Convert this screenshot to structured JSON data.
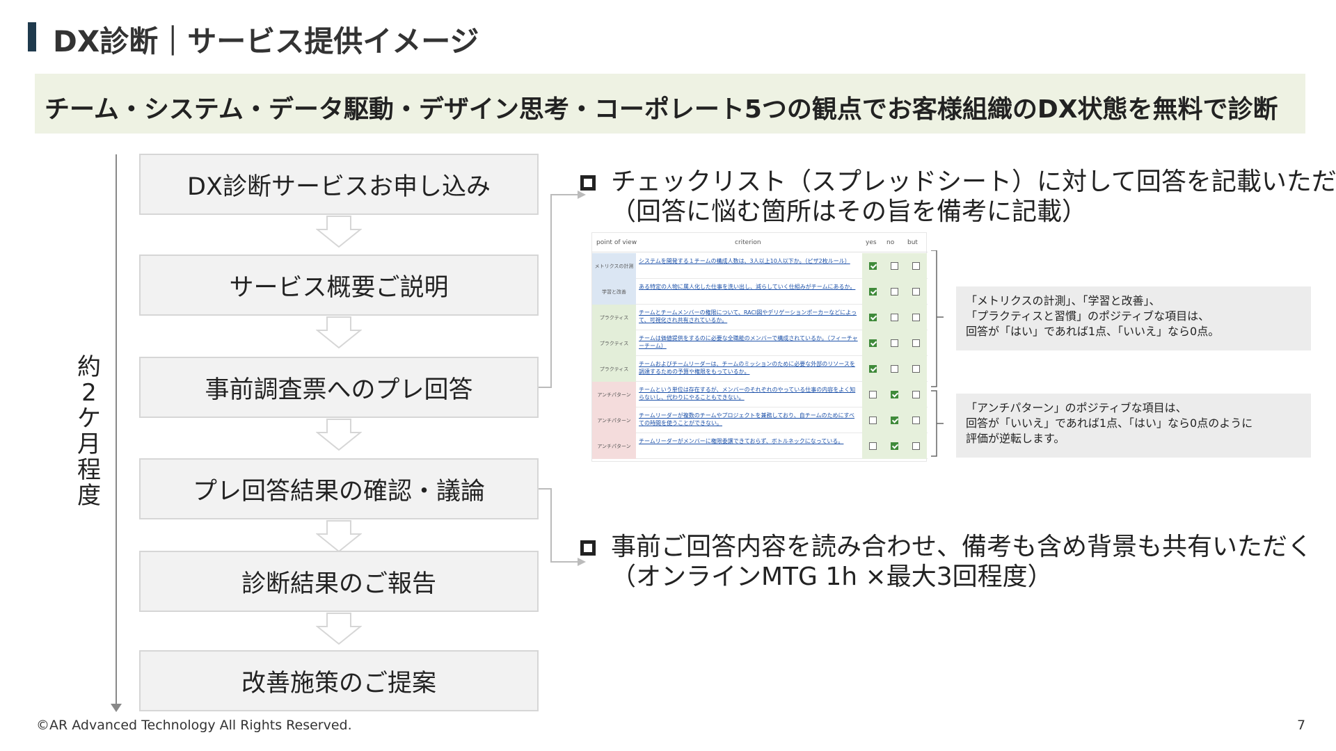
{
  "header": {
    "title": "DX診断｜サービス提供イメージ"
  },
  "banner": {
    "text": "チーム・システム・データ駆動・デザイン思考・コーポレート5つの観点でお客様組織のDX状態を無料で診断"
  },
  "timeline": {
    "label_chars": [
      "約",
      "2",
      "ケ",
      "月",
      "程",
      "度"
    ]
  },
  "steps": [
    {
      "label": "DX診断サービスお申し込み"
    },
    {
      "label": "サービス概要ご説明"
    },
    {
      "label": "事前調査票へのプレ回答"
    },
    {
      "label": "プレ回答結果の確認・議論"
    },
    {
      "label": "診断結果のご報告"
    },
    {
      "label": "改善施策のご提案"
    }
  ],
  "bullets": [
    {
      "lines": [
        "チェックリスト（スプレッドシート）に対して回答を記載いただく",
        "（回答に悩む箇所はその旨を備考に記載）"
      ]
    },
    {
      "lines": [
        "事前ご回答内容を読み合わせ、備考も含め背景も共有いただく",
        "（オンラインMTG 1h ×最大3回程度）"
      ]
    }
  ],
  "checklist": {
    "headers": {
      "point_of_view": "point of view",
      "criterion": "criterion",
      "yes": "yes",
      "no": "no",
      "but": "but"
    },
    "rows": [
      {
        "category": "メトリクスの計測",
        "criterion": "システムを開発する１チームの構成人数は、3人以上10人以下か。（ピザ2枚ルール）",
        "answer": "yes",
        "cat_color": "#dbe6f3"
      },
      {
        "category": "学習と改善",
        "criterion": "ある特定の人物に属人化した仕事を洗い出し、減らしていく仕組みがチームにあるか。",
        "answer": "yes",
        "cat_color": "#dbe6f3"
      },
      {
        "category": "プラクティス",
        "criterion": "チームとチームメンバーの権限について、RACI図やデリゲーションポーカーなどによって、可視化され共有されているか。",
        "answer": "yes",
        "cat_color": "#e3eed9"
      },
      {
        "category": "プラクティス",
        "criterion": "チームは価値提供をするのに必要な全職能のメンバーで構成されているか。（フィーチャーチーム）",
        "answer": "yes",
        "cat_color": "#e3eed9"
      },
      {
        "category": "プラクティス",
        "criterion": "チームおよびチームリーダーは、チームのミッションのために必要な外部のリソースを調達するための予算や権限をもっているか。",
        "answer": "yes",
        "cat_color": "#e3eed9"
      },
      {
        "category": "アンチパターン",
        "criterion": "チームという単位は存在するが、メンバーのそれぞれのやっている仕事の内容をよく知らないし、代わりにやることもできない。",
        "answer": "no",
        "cat_color": "#f4dcdc"
      },
      {
        "category": "アンチパターン",
        "criterion": "チームリーダーが複数のチームやプロジェクトを兼務しており、自チームのためにすべての時間を使うことができない。",
        "answer": "no",
        "cat_color": "#f4dcdc"
      },
      {
        "category": "アンチパターン",
        "criterion": "チームリーダーがメンバーに権限委譲できておらず、ボトルネックになっている。",
        "answer": "no",
        "cat_color": "#f4dcdc"
      }
    ]
  },
  "notes": [
    {
      "lines": [
        "「メトリクスの計測」、「学習と改善」、",
        "「プラクティスと習慣」のポジティブな項目は、",
        "回答が「はい」であれば1点、「いいえ」なら0点。"
      ]
    },
    {
      "lines": [
        "「アンチパターン」のポジティブな項目は、",
        "回答が「いいえ」であれば1点、「はい」なら0点のように",
        "評価が逆転します。"
      ]
    }
  ],
  "footer": {
    "copyright": "©AR Advanced Technology All Rights Reserved.",
    "page_number": "7"
  }
}
